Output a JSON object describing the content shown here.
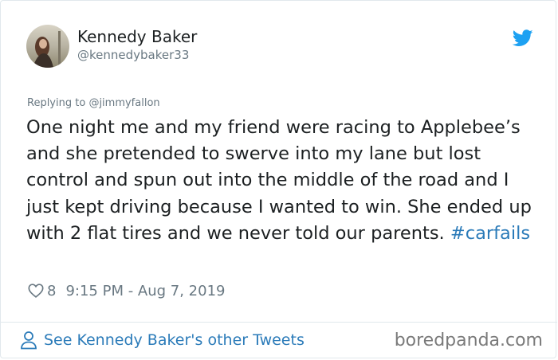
{
  "author": {
    "name": "Kennedy Baker",
    "handle": "@kennedybaker33"
  },
  "replying": {
    "prefix": "Replying to ",
    "handle": "@jimmyfallon"
  },
  "tweet": {
    "text": "One night me and my friend were racing to Applebee’s and she pretended to swerve into my lane but lost control and spun out into the middle of the road and I just kept driving because I wanted to win. She ended up with 2 flat tires and we never told our parents. ",
    "hashtag": "#carfails"
  },
  "meta": {
    "likes": "8",
    "timestamp": "9:15 PM - Aug 7, 2019"
  },
  "footer": {
    "see_more": "See Kennedy Baker's other Tweets",
    "watermark": "boredpanda.com"
  },
  "icons": {
    "bird": "twitter-bird-icon",
    "heart": "heart-outline-icon",
    "person": "person-outline-icon"
  },
  "colors": {
    "link": "#2b7bb9",
    "bird": "#1da1f2",
    "muted": "#697882",
    "text": "#1c2022",
    "border": "#e1e8ed"
  }
}
